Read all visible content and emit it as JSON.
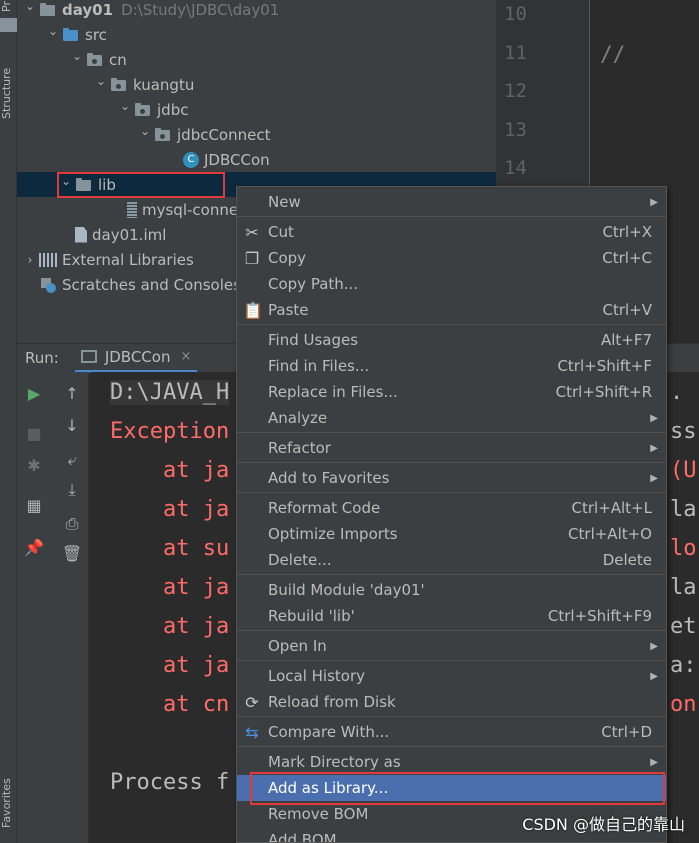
{
  "side_tabs": {
    "project": "Pr",
    "structure": "Structure",
    "favorites": "Favorites"
  },
  "project_tree": [
    {
      "label": "day01",
      "hint": "D:\\Study\\JDBC\\day01",
      "icon": "module-folder-icon",
      "expanded": true
    },
    {
      "label": "src",
      "icon": "source-folder-icon",
      "expanded": true
    },
    {
      "label": "cn",
      "icon": "package-icon",
      "expanded": true
    },
    {
      "label": "kuangtu",
      "icon": "package-icon",
      "expanded": true
    },
    {
      "label": "jdbc",
      "icon": "package-icon",
      "expanded": true
    },
    {
      "label": "jdbcConnect",
      "icon": "package-icon",
      "expanded": true
    },
    {
      "label": "JDBCCon",
      "icon": "java-class-icon",
      "class_letter": "C"
    },
    {
      "label": "lib",
      "icon": "folder-icon",
      "expanded": true,
      "selected": true
    },
    {
      "label": "mysql-connec",
      "icon": "jar-icon"
    },
    {
      "label": "day01.iml",
      "icon": "iml-file-icon"
    },
    {
      "label": "External Libraries",
      "icon": "libraries-icon",
      "expanded": false
    },
    {
      "label": "Scratches and Consoles",
      "icon": "scratches-icon"
    }
  ],
  "editor": {
    "line_numbers": [
      "10",
      "11",
      "12",
      "13",
      "14"
    ],
    "visible_code": "//"
  },
  "run_panel": {
    "label": "Run:",
    "tab": "JDBCCon",
    "tab_close": "×",
    "console_lines": [
      {
        "text": "D:\\JAVA_H",
        "style": "grey"
      },
      {
        "text": "Exception",
        "style": "red"
      },
      {
        "text": "    at ja",
        "style": "red"
      },
      {
        "text": "    at ja",
        "style": "red"
      },
      {
        "text": "    at su",
        "style": "red"
      },
      {
        "text": "    at ja",
        "style": "red"
      },
      {
        "text": "    at ja",
        "style": "red"
      },
      {
        "text": "    at ja",
        "style": "red"
      },
      {
        "text": "    at cn",
        "style": "red"
      },
      {
        "text": "",
        "style": "grey"
      },
      {
        "text": "Process f",
        "style": "grey"
      }
    ],
    "right_fragments": [
      {
        "text": ".",
        "style": "grey"
      },
      {
        "text": "ss",
        "style": "grey"
      },
      {
        "text": "(U",
        "style": "red"
      },
      {
        "text": "la",
        "style": "grey"
      },
      {
        "text": "lo",
        "style": "red"
      },
      {
        "text": "la",
        "style": "grey"
      },
      {
        "text": "et",
        "style": "grey"
      },
      {
        "text": "a:",
        "style": "grey"
      },
      {
        "text": "on",
        "style": "red"
      }
    ],
    "tools_left": [
      "run-icon",
      "stop-icon",
      "debug-icon",
      "layout-icon",
      "pin-icon"
    ],
    "tools_right": [
      "up-arrow-icon",
      "down-arrow-icon",
      "soft-wrap-icon",
      "scroll-to-end-icon",
      "print-icon",
      "trash-icon"
    ]
  },
  "context_menu": {
    "items": [
      {
        "label": "New",
        "shortcut": "",
        "submenu": true,
        "icon": ""
      },
      {
        "sep": true
      },
      {
        "label": "Cut",
        "mnemonic": "t",
        "shortcut": "Ctrl+X",
        "icon": "scissors-icon"
      },
      {
        "label": "Copy",
        "mnemonic": "C",
        "shortcut": "Ctrl+C",
        "icon": "copy-icon"
      },
      {
        "label": "Copy Path...",
        "shortcut": "",
        "icon": ""
      },
      {
        "label": "Paste",
        "mnemonic": "P",
        "shortcut": "Ctrl+V",
        "icon": "paste-icon"
      },
      {
        "sep": true
      },
      {
        "label": "Find Usages",
        "shortcut": "Alt+F7",
        "icon": ""
      },
      {
        "label": "Find in Files...",
        "shortcut": "Ctrl+Shift+F",
        "icon": ""
      },
      {
        "label": "Replace in Files...",
        "shortcut": "Ctrl+Shift+R",
        "icon": ""
      },
      {
        "label": "Analyze",
        "shortcut": "",
        "submenu": true,
        "icon": ""
      },
      {
        "sep": true
      },
      {
        "label": "Refactor",
        "shortcut": "",
        "submenu": true,
        "icon": ""
      },
      {
        "sep": true
      },
      {
        "label": "Add to Favorites",
        "shortcut": "",
        "submenu": true,
        "icon": ""
      },
      {
        "sep": true
      },
      {
        "label": "Reformat Code",
        "shortcut": "Ctrl+Alt+L",
        "icon": ""
      },
      {
        "label": "Optimize Imports",
        "shortcut": "Ctrl+Alt+O",
        "icon": ""
      },
      {
        "label": "Delete...",
        "shortcut": "Delete",
        "icon": ""
      },
      {
        "sep": true
      },
      {
        "label": "Build Module 'day01'",
        "shortcut": "",
        "icon": ""
      },
      {
        "label": "Rebuild 'lib'",
        "shortcut": "Ctrl+Shift+F9",
        "icon": ""
      },
      {
        "sep": true
      },
      {
        "label": "Open In",
        "shortcut": "",
        "submenu": true,
        "icon": ""
      },
      {
        "sep": true
      },
      {
        "label": "Local History",
        "shortcut": "",
        "submenu": true,
        "icon": ""
      },
      {
        "label": "Reload from Disk",
        "shortcut": "",
        "icon": "reload-icon"
      },
      {
        "sep": true
      },
      {
        "label": "Compare With...",
        "shortcut": "Ctrl+D",
        "icon": "compare-icon"
      },
      {
        "sep": true
      },
      {
        "label": "Mark Directory as",
        "shortcut": "",
        "submenu": true,
        "icon": ""
      },
      {
        "label": "Add as Library...",
        "shortcut": "",
        "icon": "",
        "highlighted": true
      },
      {
        "label": "Remove BOM",
        "shortcut": "",
        "icon": ""
      },
      {
        "label": "Add BOM",
        "shortcut": "",
        "icon": ""
      }
    ]
  },
  "watermark": "CSDN @做自己的靠山",
  "colors": {
    "highlight": "#4b6eaf",
    "selection": "#0d293e",
    "error_text": "#ff6b68",
    "annotation_box": "#e03a3a"
  }
}
